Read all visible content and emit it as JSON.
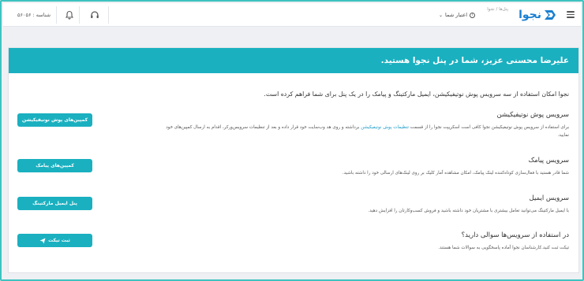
{
  "header": {
    "logo_text": "نجوا",
    "breadcrumb": "پنل‌ها / نجوا",
    "credit_label": "اعتبار شما",
    "user_id": "شناسه : ۵۶۰۵۶"
  },
  "banner": {
    "title": "علیرضا محسنی عزیز، شما در پنل نجوا هستید."
  },
  "intro": "نجوا امکان استفاده از سه سرویس پوش نوتیفیکیشن، ایمیل مارکتینگ و پیامک را در یک پنل برای شما فراهم کرده است.",
  "sections": [
    {
      "title": "سرویس پوش نوتیفیکیشن",
      "desc_before": "برای استفاده از سرویس پوش نوتیفیکیشن نجوا کافی است اسکریپت نجوا را از قسمت ",
      "desc_link": "تنظیمات پوش نوتیفیکیشن",
      "desc_after": " برداشته و روی هد وب‌سایت خود قرار داده و بعد از تنظیمات سرویس‌ورکر، اقدام به ارسال کمپین‌های خود نمایید.",
      "button": "کمپین‌های پوش نوتیفیکیشن"
    },
    {
      "title": "سرویس پیامک",
      "desc": "شما قادر هستید با فعال‌سازی کوتاه‌کننده لینک پیامک، امکان مشاهده آمار کلیک بر روی لینک‌های ارسالی خود را داشته باشید.",
      "button": "کمپین‌های پیامک"
    },
    {
      "title": "سرویس ایمیل",
      "desc": "با ایمیل مارکتینگ می‌توانید تعامل بیشتری با مشتریان خود داشته باشید و فروش کسب‌وکارتان را افزایش دهید.",
      "button": "پنل ایمیل مارکتینگ"
    },
    {
      "title": "در استفاده از سرویس‌ها سوالی دارید؟",
      "desc": "تیکت ثبت کنید.کارشناسان نجوا آماده پاسخگویی به سوالات شما هستند.",
      "button": "ثبت تیکت"
    }
  ],
  "colors": {
    "accent": "#1ab0c0",
    "logo": "#1a7fd0",
    "link": "#1a9ac7"
  },
  "icons": [
    "menu-icon",
    "info-icon",
    "headset-icon",
    "bell-icon",
    "send-icon"
  ]
}
